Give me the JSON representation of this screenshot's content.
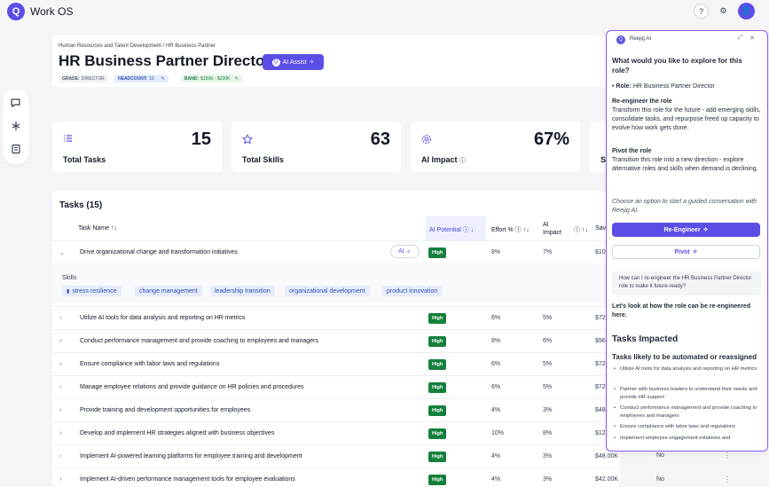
{
  "app": {
    "logo_letter": "Q",
    "title": "Work OS"
  },
  "topbar": {
    "help_glyph": "?",
    "settings_glyph": "⚙",
    "avatar_glyph": "👤"
  },
  "header": {
    "breadcrumb": "Human Resources and Talent Development / HR Business Partner",
    "title": "HR Business Partner Director",
    "ai_assist_label": "AI Assist",
    "grade_label": "GRADE:",
    "grade_value": "DIRECTOR",
    "headcount_label": "HEADCOUNT:",
    "headcount_value": "10",
    "band_label": "BAND:",
    "band_value": "$150K - $230K"
  },
  "stats": [
    {
      "label": "Total Tasks",
      "value": "15",
      "icon": "list-icon"
    },
    {
      "label": "Total Skills",
      "value": "63",
      "icon": "star-icon"
    },
    {
      "label": "AI Impact",
      "value": "67%",
      "icon": "gear-icon"
    },
    {
      "label": "S",
      "value": "",
      "icon": ""
    }
  ],
  "tasks": {
    "title": "Tasks (15)",
    "columns": {
      "name": "Task Name",
      "ai_potential": "AI Potential",
      "effort": "Effort %",
      "ai_impact_1": "AI",
      "ai_impact_2": "Impact",
      "savings": "Sav"
    },
    "ai_button_label": "AI",
    "skills_label": "Skills",
    "skills": [
      "stress resilience",
      "change management",
      "leadership transition",
      "organizational development",
      "product innovation"
    ],
    "rows": [
      {
        "name": "Drive organizational change and transformation initiatives",
        "potential": "High",
        "effort": "8%",
        "impact": "7%",
        "savings": "$10",
        "flag": ""
      },
      {
        "name": "Utilize AI tools for data analysis and reporting on HR metrics",
        "potential": "High",
        "effort": "6%",
        "impact": "5%",
        "savings": "$72",
        "flag": ""
      },
      {
        "name": "Conduct performance management and provide coaching to employees and managers",
        "potential": "High",
        "effort": "8%",
        "impact": "6%",
        "savings": "$96",
        "flag": ""
      },
      {
        "name": "Ensure compliance with labor laws and regulations",
        "potential": "High",
        "effort": "6%",
        "impact": "5%",
        "savings": "$72",
        "flag": ""
      },
      {
        "name": "Manage employee relations and provide guidance on HR policies and procedures",
        "potential": "High",
        "effort": "6%",
        "impact": "5%",
        "savings": "$72",
        "flag": ""
      },
      {
        "name": "Provide training and development opportunities for employees",
        "potential": "High",
        "effort": "4%",
        "impact": "3%",
        "savings": "$48",
        "flag": ""
      },
      {
        "name": "Develop and implement HR strategies aligned with business objectives",
        "potential": "High",
        "effort": "10%",
        "impact": "8%",
        "savings": "$12",
        "flag": ""
      },
      {
        "name": "Implement AI-powered learning platforms for employee training and development",
        "potential": "High",
        "effort": "4%",
        "impact": "3%",
        "savings": "$48.00K",
        "flag": "No"
      },
      {
        "name": "Implement AI-driven performance management tools for employee evaluations",
        "potential": "High",
        "effort": "4%",
        "impact": "3%",
        "savings": "$42.00K",
        "flag": "No"
      }
    ]
  },
  "panel": {
    "title": "Reejig AI",
    "logo_letter": "Q",
    "question": "What would you like to explore for this role?",
    "role_label": "Role:",
    "role_value": "HR Business Partner Director",
    "reengineer_heading": "Re-engineer the role",
    "reengineer_text": "Transform this role for the future - add emerging skills, consolidate tasks, and repurpose freed up capacity to evolve how work gets done.",
    "pivot_heading": "Pivot the role",
    "pivot_text": "Transition this role into a new direction - explore alternative roles and skills when demand is declining.",
    "choose_text": "Choose an option to start a guided conversation with Reejig AI.",
    "reengineer_button": "Re-Engineer",
    "pivot_button": "Pivot",
    "user_message": "How can I re-engineer the HR Business Partner Director role to make it future-ready?",
    "reply_intro": "Let's look at how the role can be re-engineered here.",
    "tasks_impacted_heading": "Tasks Impacted",
    "tasks_automated_heading": "Tasks likely to be automated or reassigned",
    "impacted_tasks": [
      "Utilize AI tools for data analysis and reporting on HR metrics",
      "Partner with business leaders to understand their needs and provide HR support",
      "Conduct performance management and provide coaching to employees and managers",
      "Ensure compliance with labor laws and regulations",
      "Implement employee engagement initiatives and"
    ]
  },
  "colors": {
    "accent": "#5b4ee6",
    "badge_high": "#15803d",
    "panel_border": "#8b5cf6"
  }
}
